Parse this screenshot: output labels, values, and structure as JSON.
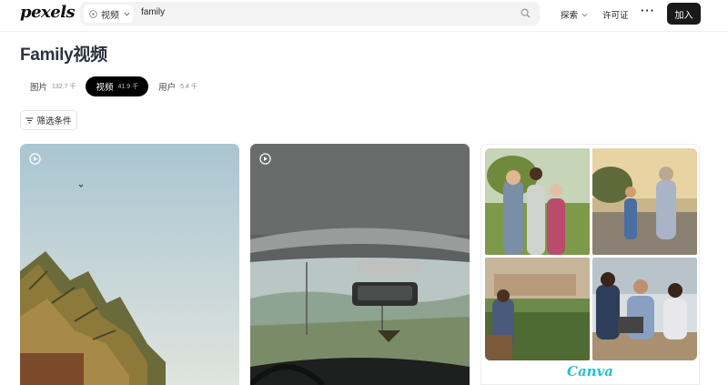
{
  "header": {
    "logo": "pexels",
    "search": {
      "type_label": "视频",
      "query": "family"
    },
    "nav": {
      "explore": "探索",
      "license": "许可证",
      "more": "···"
    },
    "join_label": "加入"
  },
  "page_title": "Family视频",
  "tabs": [
    {
      "label": "图片",
      "count": "132.7 千",
      "active": false
    },
    {
      "label": "视频",
      "count": "41.9 千",
      "active": true
    },
    {
      "label": "用户",
      "count": "5.4 千",
      "active": false
    }
  ],
  "filter_label": "筛选条件",
  "ad": {
    "brand": "Canva"
  },
  "colors": {
    "accent": "#1a1a1a",
    "canva": "#20c4cb"
  }
}
